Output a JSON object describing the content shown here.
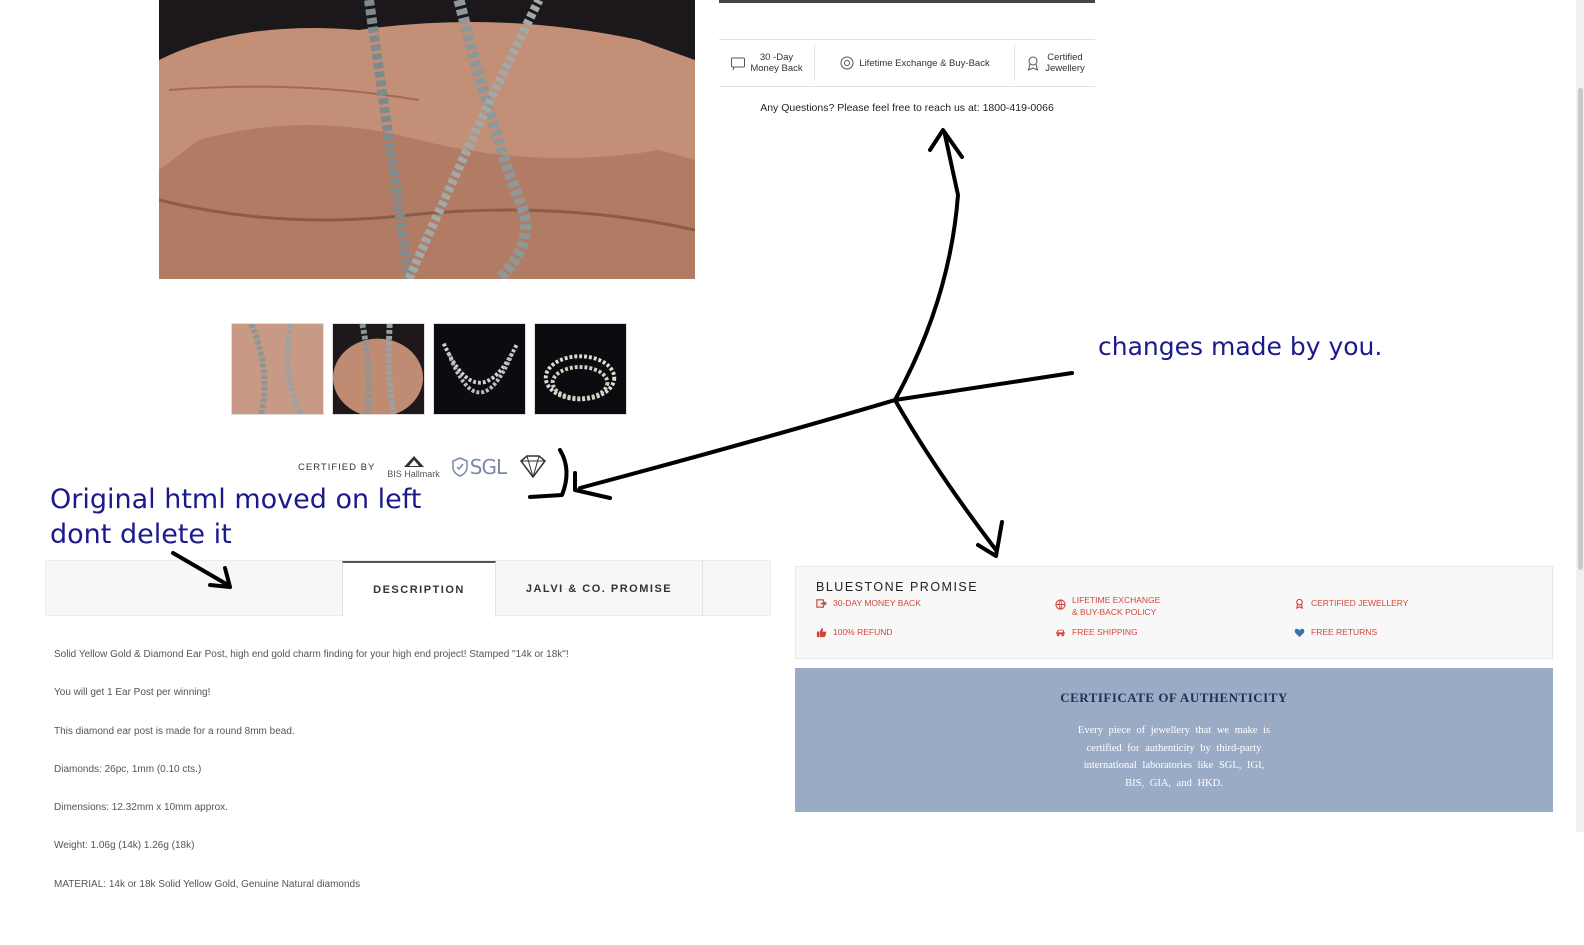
{
  "trust_bar": {
    "item1_line1": "30 -Day",
    "item1_line2": "Money Back",
    "item2": "Lifetime Exchange & Buy-Back",
    "item3_line1": "Certified",
    "item3_line2": "Jewellery"
  },
  "questions": "Any Questions? Please feel free to reach us at: 1800-419-0066",
  "certified_by": {
    "label": "CERTIFIED BY",
    "bis": "BIS Hallmark",
    "sgl": "SGL"
  },
  "tabs": {
    "description": "DESCRIPTION",
    "promise": "JALVI & CO. PROMISE"
  },
  "description": [
    "Solid Yellow Gold & Diamond Ear Post, high end gold charm finding for your high end project! Stamped \"14k or 18k\"!",
    "You will get 1 Ear Post per winning!",
    "This diamond ear post is made for a round 8mm bead.",
    "Diamonds: 26pc, 1mm (0.10 cts.)",
    "Dimensions: 12.32mm x 10mm approx.",
    "Weight: 1.06g (14k) 1.26g (18k)",
    "MATERIAL: 14k or 18k Solid Yellow Gold, Genuine Natural diamonds"
  ],
  "bluestone_promise": {
    "title": "BLUESTONE PROMISE",
    "items": [
      {
        "label": "30-DAY MONEY BACK",
        "icon": "money-back-icon"
      },
      {
        "label_line1": "LIFETIME EXCHANGE",
        "label_line2": "& BUY-BACK POLICY",
        "icon": "globe-icon"
      },
      {
        "label": "CERTIFIED JEWELLERY",
        "icon": "award-icon"
      },
      {
        "label": "100% REFUND",
        "icon": "thumbs-up-icon"
      },
      {
        "label": "FREE SHIPPING",
        "icon": "car-icon"
      },
      {
        "label": "FREE RETURNS",
        "icon": "heart-icon"
      }
    ]
  },
  "certificate": {
    "title": "CERTIFICATE  OF  AUTHENTICITY",
    "body": "Every piece of jewellery that we make is certified for authenticity by third-party international laboratories like SGL, IGI, BIS, GIA, and HKD."
  },
  "annotations": {
    "right": "changes made by you.",
    "left_line1": "Original html moved on left",
    "left_line2": "dont delete it"
  },
  "colors": {
    "promise_red": "#d0473a",
    "certificate_bg": "#9aabc6",
    "certificate_title": "#1f2f55",
    "annotation_blue": "#1a1a8c"
  }
}
